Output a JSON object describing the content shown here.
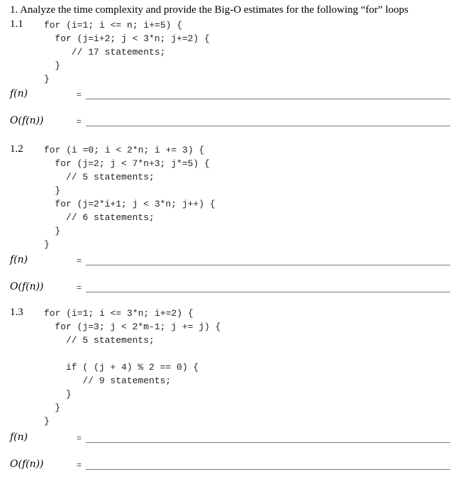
{
  "heading": "1.  Analyze the time complexity and provide the Big-O estimates for the following “for” loops",
  "problems": [
    {
      "number": "1.1",
      "code": [
        "for (i=1; i <= n; i+=5) {",
        "   for (j=i+2; j < 3*n; j+=2) {",
        "      // 17 statements;",
        "   }",
        "}"
      ],
      "f_label": "f(n)",
      "o_label": "O(f(n))",
      "equals": "=",
      "f_answer": "",
      "o_answer": ""
    },
    {
      "number": "1.2",
      "code": [
        "for (i =0; i < 2*n; i += 3) {",
        "   for (j=2; j < 7*n+3; j*=5) {",
        "     // 5 statements;",
        "   }",
        "   for (j=2*i+1; j < 3*n; j++) {",
        "     // 6 statements;",
        "   }",
        "}"
      ],
      "f_label": "f(n)",
      "o_label": "O(f(n))",
      "equals": "=",
      "f_answer": "",
      "o_answer": ""
    },
    {
      "number": "1.3",
      "code": [
        "for (i=1; i <= 3*n; i+=2) {",
        "   for (j=3; j < 2*m-1; j += j) {",
        "     // 5 statements;",
        "",
        "     if ( (j + 4) % 2 == 0) {",
        "        // 9 statements;",
        "     }",
        "   }",
        "}"
      ],
      "f_label": "f(n)",
      "o_label": "O(f(n))",
      "equals": "=",
      "f_answer": "",
      "o_answer": ""
    }
  ]
}
